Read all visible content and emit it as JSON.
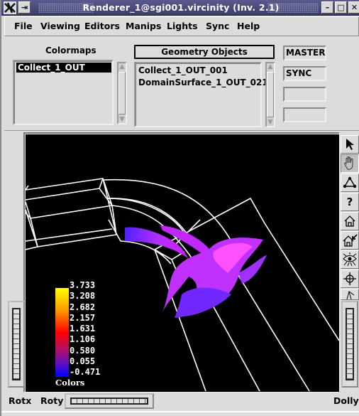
{
  "window": {
    "title": "Renderer_1@sgi001.vircinity (Inv. 2.1)",
    "controls": {
      "minimize": "–",
      "maximize": "□",
      "close": "✕",
      "pin": "⇥"
    }
  },
  "menu": [
    "File",
    "Viewing",
    "Editors",
    "Manips",
    "Lights",
    "Sync",
    "Help"
  ],
  "colormaps": {
    "label": "Colormaps",
    "items": [
      "Collect_1_OUT"
    ],
    "selected": "Collect_1_OUT"
  },
  "geometry": {
    "label": "Geometry Objects",
    "items": [
      "Collect_1_OUT_001",
      "DomainSurface_1_OUT_021"
    ]
  },
  "side_buttons": [
    {
      "label": "MASTER"
    },
    {
      "label": "SYNC"
    },
    {
      "label": ""
    },
    {
      "label": ""
    }
  ],
  "toolbar": [
    {
      "name": "pick-arrow",
      "tooltip": "select"
    },
    {
      "name": "hand",
      "tooltip": "view",
      "active": true
    },
    {
      "name": "seek",
      "tooltip": "seek"
    },
    {
      "name": "help",
      "glyph": "?"
    },
    {
      "name": "home",
      "tooltip": "home"
    },
    {
      "name": "set-home",
      "tooltip": "set home"
    },
    {
      "name": "view-all",
      "tooltip": "view all"
    },
    {
      "name": "seek-target",
      "tooltip": "seek"
    },
    {
      "name": "perspective",
      "tooltip": "camera"
    }
  ],
  "legend": {
    "title": "Colors",
    "values": [
      "3.733",
      "3.208",
      "2.682",
      "2.157",
      "1.631",
      "1.106",
      "0.580",
      "0.055",
      "-0.471"
    ],
    "colors": {
      "max": "#ffff00",
      "mid_high": "#ff8c00",
      "mid": "#ff0000",
      "mid_low": "#a000a0",
      "min": "#0000ff"
    }
  },
  "bottom": {
    "rotx": "Rotx",
    "roty": "Roty",
    "dolly": "Dolly"
  },
  "scene": {
    "background": "#000000",
    "wire_color": "#ffffff",
    "surface_colors": [
      "#e020ff",
      "#a030ff",
      "#7020ff",
      "#ff40ff"
    ]
  }
}
